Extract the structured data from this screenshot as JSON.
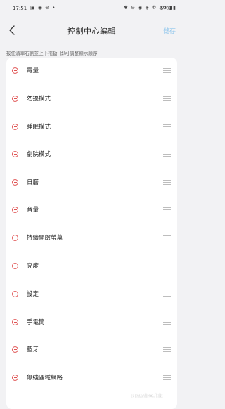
{
  "status_bar": {
    "time": "17:51",
    "left_icons": "▣ ◉ ⊛ •",
    "right_icons": "✱ ⊖ ◉ ◈ ✆ 5G ▮▮",
    "battery": "57%"
  },
  "header": {
    "back_icon": "chevron-left-icon",
    "title": "控制中心編輯",
    "save_label": "儲存"
  },
  "hint": "按住清單右側並上下拖動, 即可調整顯示順序",
  "items": [
    {
      "label": "電量"
    },
    {
      "label": "勿擾模式"
    },
    {
      "label": "睡眠模式"
    },
    {
      "label": "劇院模式"
    },
    {
      "label": "日曆"
    },
    {
      "label": "音量"
    },
    {
      "label": "持續開啟螢幕"
    },
    {
      "label": "亮度"
    },
    {
      "label": "設定"
    },
    {
      "label": "手電筒"
    },
    {
      "label": "藍牙"
    },
    {
      "label": "無綫區域網路"
    }
  ],
  "watermark": "unwire.hk",
  "colors": {
    "remove": "#e05353",
    "save_disabled": "#8fc6ec",
    "background": "#f2f2f4"
  }
}
